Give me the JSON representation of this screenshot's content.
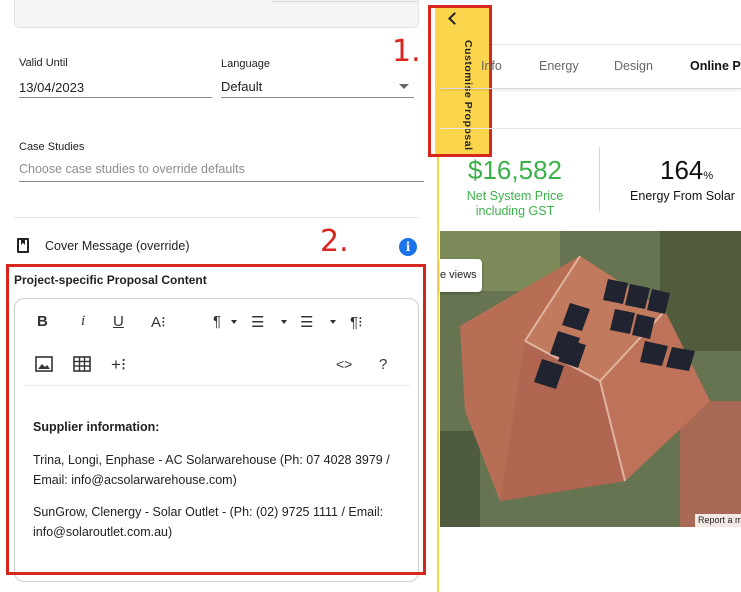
{
  "form": {
    "valid_until": {
      "label": "Valid Until",
      "value": "13/04/2023"
    },
    "language": {
      "label": "Language",
      "value": "Default"
    },
    "case_studies": {
      "label": "Case Studies",
      "placeholder": "Choose case studies to override defaults"
    },
    "cover_message": {
      "label": "Cover Message (override)"
    },
    "project_content": {
      "title": "Project-specific Proposal Content",
      "toolbar": {
        "bold": "B",
        "italic": "i",
        "underline": "U",
        "font_size": "A⁝",
        "paragraph": "¶",
        "ordered_list": "☰",
        "bullet_list": "☰",
        "paragraph_format": "¶⁝",
        "image": "image",
        "table": "table",
        "more": "+⁝",
        "code": "<>",
        "help": "?"
      },
      "body": {
        "heading": "Supplier information:",
        "line1": "Trina, Longi, Enphase - AC Solarwarehouse (Ph: 07 4028 3979 / Email: info@acsolarwarehouse.com)",
        "line2": "SunGrow, Clenergy - Solar Outlet - (Ph: (02) 9725 1111 / Email: info@solaroutlet.com.au)"
      }
    }
  },
  "annotations": {
    "one": "1.",
    "two": "2."
  },
  "side_tab": {
    "label": "Customise Proposal"
  },
  "preview": {
    "tabs": [
      "Info",
      "Energy",
      "Design",
      "Online Pr"
    ],
    "net_price": {
      "value": "$16,582",
      "label_line1": "Net System Price",
      "label_line2": "including GST"
    },
    "energy": {
      "value": "164",
      "unit": "%",
      "label": "Energy From Solar"
    },
    "views_button": "e views",
    "report_link": "Report a m"
  },
  "colors": {
    "accent_yellow": "#fbd54b",
    "annotation_red": "#d7261e",
    "price_green": "#3bb14a",
    "info_blue": "#1a73e8"
  }
}
